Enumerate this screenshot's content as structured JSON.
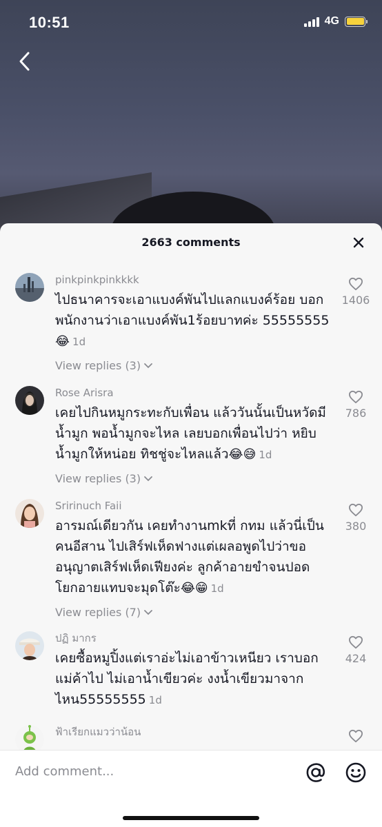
{
  "status_bar": {
    "time": "10:51",
    "network": "4G"
  },
  "sheet": {
    "title": "2663 comments"
  },
  "comments": [
    {
      "username": "pinkpinkpinkkkk",
      "text": "ไปธนาคารจะเอาแบงค์พันไปแลกแบงค์ร้อย บอกพนักงานว่าเอาแบงค์พัน1ร้อยบาทค่ะ 55555555",
      "emoji": "😂",
      "time": "1d",
      "replies": "View replies (3)",
      "likes": "1406"
    },
    {
      "username": "Rose Arisra",
      "text": "เคยไปกินหมูกระทะกับเพื่อน แล้ววันนั้นเป็นหวัดมีน้ำมูก พอน้ำมูกจะไหล เลยบอกเพื่อนไปว่า หยิบน้ำมูกให้หน่อย ทิชชู่จะไหลแล้ว",
      "emoji": "😂😅",
      "time": "1d",
      "replies": "View replies (3)",
      "likes": "786"
    },
    {
      "username": "Sririnuch Faii",
      "text": "อารมณ์เดียวกัน เคยทำงานmkที่ กทม แล้วนี่เป็นคนอีสาน ไปเสิร์ฟเห็ดฟางแต่เผลอพูดไปว่าขออนุญาตเสิร์ฟเห็ดเฟียงค่ะ ลูกค้าอายขำจนปอด โยกอายแทบจะมุดโต๊ะ",
      "emoji": "😂😁",
      "time": "1d",
      "replies": "View replies (7)",
      "likes": "380"
    },
    {
      "username": "ปฏิ มากร",
      "text": "เคยซื้อหมูปิ้งแต่เราอ่ะไม่เอาข้าวเหนียว เราบอกแม่ค้าไป ไม่เอาน้ำเขียวค่ะ งงน้ำเขียวมาจากไหน55555555",
      "emoji": "",
      "time": "1d",
      "replies": "",
      "likes": "424"
    },
    {
      "username": "ฟ้าเรียกแมวว่าน้อน",
      "text": "",
      "emoji": "",
      "time": "",
      "replies": "",
      "likes": ""
    }
  ],
  "footer": {
    "placeholder": "Add comment..."
  }
}
